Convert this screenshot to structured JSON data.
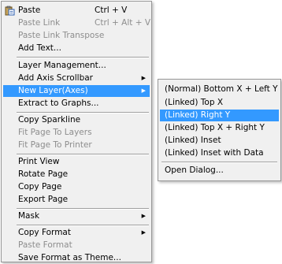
{
  "main_menu": {
    "items": [
      {
        "label": "Paste",
        "shortcut": "Ctrl + V",
        "icon": "paste-icon"
      },
      {
        "label": "Paste Link",
        "shortcut": "Ctrl + Alt + V"
      },
      {
        "label": "Paste Link Transpose"
      },
      {
        "label": "Add Text..."
      },
      {
        "label": "Layer Management..."
      },
      {
        "label": "Add Axis Scrollbar"
      },
      {
        "label": "New Layer(Axes)"
      },
      {
        "label": "Extract to Graphs..."
      },
      {
        "label": "Copy Sparkline"
      },
      {
        "label": "Fit Page To Layers"
      },
      {
        "label": "Fit Page To Printer"
      },
      {
        "label": "Print View"
      },
      {
        "label": "Rotate Page"
      },
      {
        "label": "Copy Page"
      },
      {
        "label": "Export Page"
      },
      {
        "label": "Mask"
      },
      {
        "label": "Copy Format"
      },
      {
        "label": "Paste Format"
      },
      {
        "label": "Save Format as Theme..."
      }
    ]
  },
  "sub_menu": {
    "items": [
      {
        "label": "(Normal) Bottom X + Left Y"
      },
      {
        "label": "(Linked) Top X"
      },
      {
        "label": "(Linked) Right Y"
      },
      {
        "label": "(Linked) Top X + Right Y"
      },
      {
        "label": "(Linked) Inset"
      },
      {
        "label": "(Linked) Inset with Data"
      },
      {
        "label": "Open Dialog..."
      }
    ]
  },
  "arrow_glyph": "▶",
  "colors": {
    "highlight": "#3399ff",
    "disabled_text": "#8d8d8d",
    "menu_bg": "#f0f0f0"
  }
}
